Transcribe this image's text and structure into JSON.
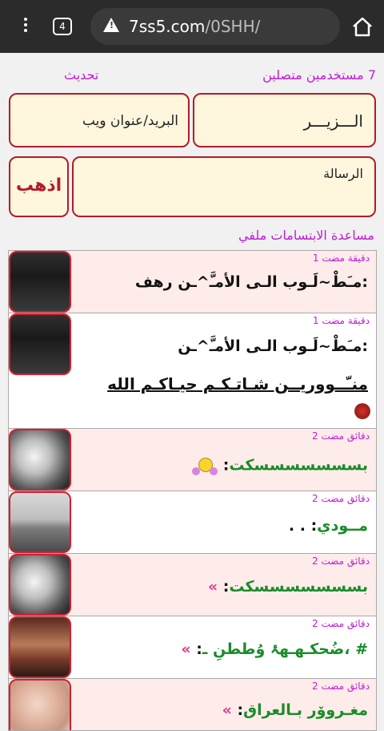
{
  "browser": {
    "tab_count": "4",
    "url_host": "7ss5.com",
    "url_path": "/0SHH/"
  },
  "header": {
    "online_users": "7 مستخدمين متصلين",
    "refresh_label": "تحديث"
  },
  "form": {
    "name_value": "الـــزيـــر",
    "email_placeholder": "البريد/عنوان ويب",
    "message_placeholder": "الرسالة",
    "go_button": "اذهب"
  },
  "help_text": "مساعدة الابتسامات ملفي",
  "messages": [
    {
      "time": "دقيقة مضت 1",
      "name": "رهف",
      "text": ":مـَطْ~لَـوب الـى الأمـَّ^ـن",
      "avatar": "dark-figure"
    },
    {
      "time": "دقيقة مضت 1",
      "name": "",
      "text": ":مـَطْ~لَـوب الـى الأمـَّ^ـن",
      "text2": "منـّــووريــن شـاتـكـم حيـاكـم الله",
      "avatar": "dark-figure"
    },
    {
      "time": "دقائق مضت 2",
      "name": "بسسسسسسسكت",
      "text": "",
      "avatar": "bw-face"
    },
    {
      "time": "دقائق مضت 2",
      "name": "مــودي",
      "text": ". .",
      "avatar": "lake-silhouette"
    },
    {
      "time": "دقائق مضت 2",
      "name": "بسسسسسسسكت",
      "text": "»",
      "avatar": "bw-face"
    },
    {
      "time": "دقائق مضت 2",
      "name": "# ،ضُحكـهـهۂ وُططنِ ـ",
      "text": "»",
      "avatar": "girl-photo"
    },
    {
      "time": "دقائق مضت 2",
      "name": "مغـروۆر بـالعراق",
      "text": "»",
      "avatar": "hand-photo"
    }
  ],
  "colors": {
    "accent_purple": "#c21bd6",
    "border_red": "#b11c2b",
    "input_bg": "#fff6de",
    "row_pink": "#fdecea",
    "green_name": "#1a8c2a"
  }
}
